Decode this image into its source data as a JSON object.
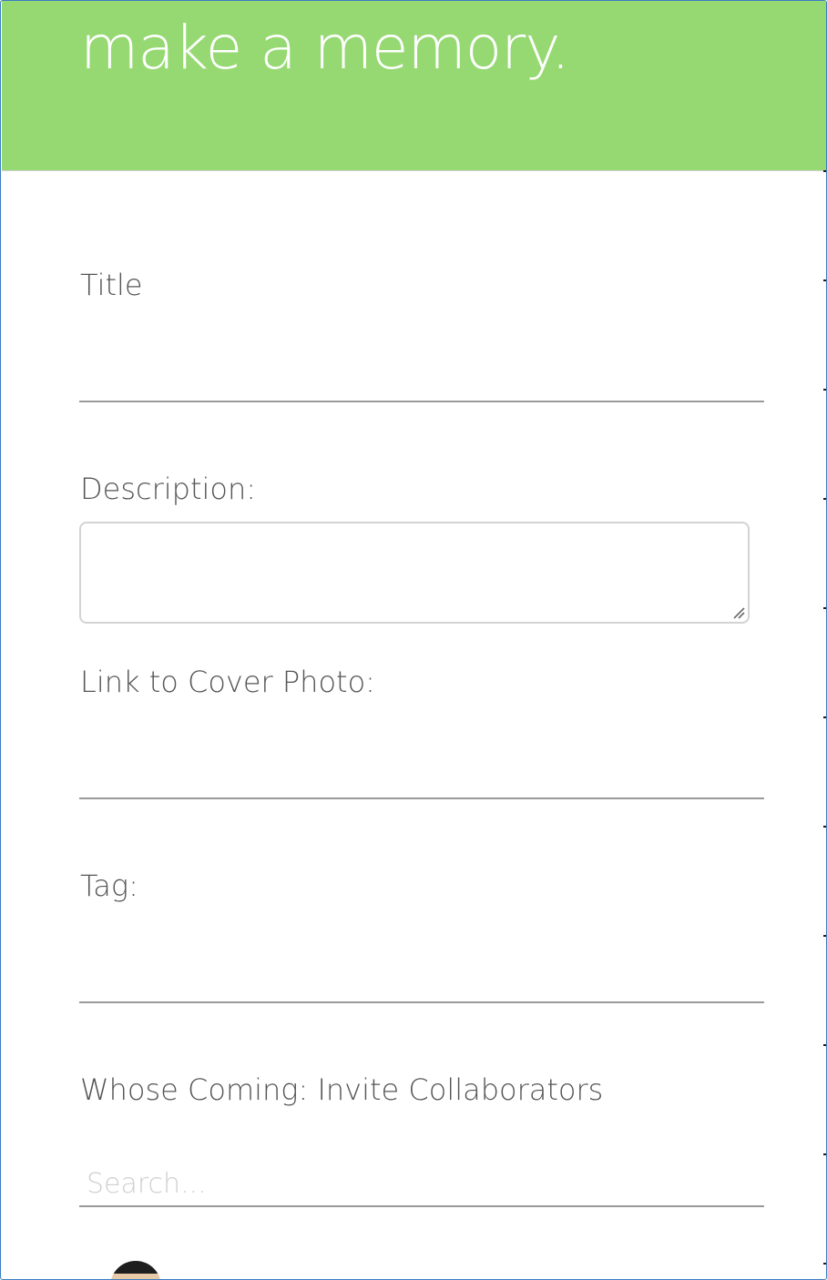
{
  "header": {
    "title": "make a memory.",
    "background_color": "#96d973"
  },
  "form": {
    "title_label": "Title",
    "title_value": "",
    "description_label": "Description:",
    "description_value": "",
    "cover_photo_label": "Link to Cover Photo:",
    "cover_photo_value": "",
    "tag_label": "Tag:",
    "tag_value": "",
    "collaborators_label": "Whose Coming: Invite Collaborators",
    "search_placeholder": "Search...",
    "search_value": ""
  },
  "collaborators": [
    {
      "avatar": "user-avatar"
    }
  ]
}
